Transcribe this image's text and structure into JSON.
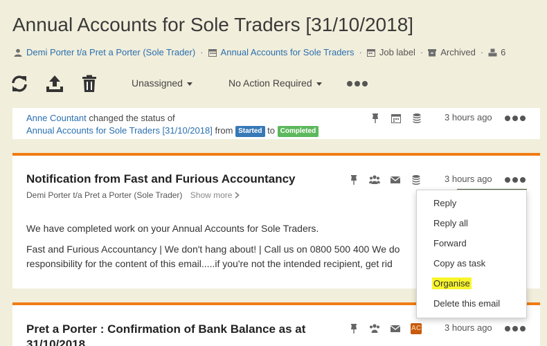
{
  "page": {
    "title": "Annual Accounts for Sole Traders [31/10/2018]"
  },
  "meta": {
    "client": "Demi Porter t/a Pret a Porter (Sole Trader)",
    "job": "Annual Accounts for Sole Traders",
    "job_label": "Job label",
    "archived": "Archived",
    "count": "6",
    "sep": "·"
  },
  "toolbar": {
    "assignee": "Unassigned",
    "action": "No Action Required"
  },
  "activity": {
    "user": "Anne Countant",
    "verb": " changed the status of",
    "job_link": "Annual Accounts for Sole Traders [31/10/2018]",
    "from_word": " from ",
    "from_status": "Started",
    "to_word": " to ",
    "to_status": "Completed",
    "time": "3 hours ago"
  },
  "email1": {
    "title": "Notification from Fast and Furious Accountancy",
    "sender": "Demi Porter t/a Pret a Porter (Sole Trader)",
    "show_more": "Show more",
    "time": "3 hours ago",
    "line1": "We have completed work on your Annual Accounts for Sole Traders.",
    "line2": "Fast and Furious Accountancy | We don't hang about! | Call us on 0800 500 400 We do",
    "line3": "responsibility for the content of this email.....if you're not the intended recipient, get rid"
  },
  "email2": {
    "title_line1": "Pret a Porter : Confirmation of Bank Balance as at",
    "title_line2": "31/10/2018",
    "time": "3 hours ago",
    "badge": "AC"
  },
  "menu": {
    "items": [
      "Reply",
      "Reply all",
      "Forward",
      "Copy as task",
      "Organise",
      "Delete this email"
    ],
    "highlight_color": "#f9f52b"
  },
  "colors": {
    "background": "#f1eedb",
    "link": "#2a6fb0",
    "accent_orange": "#f07c13",
    "started": "#3778b7",
    "completed": "#5cb85c"
  }
}
